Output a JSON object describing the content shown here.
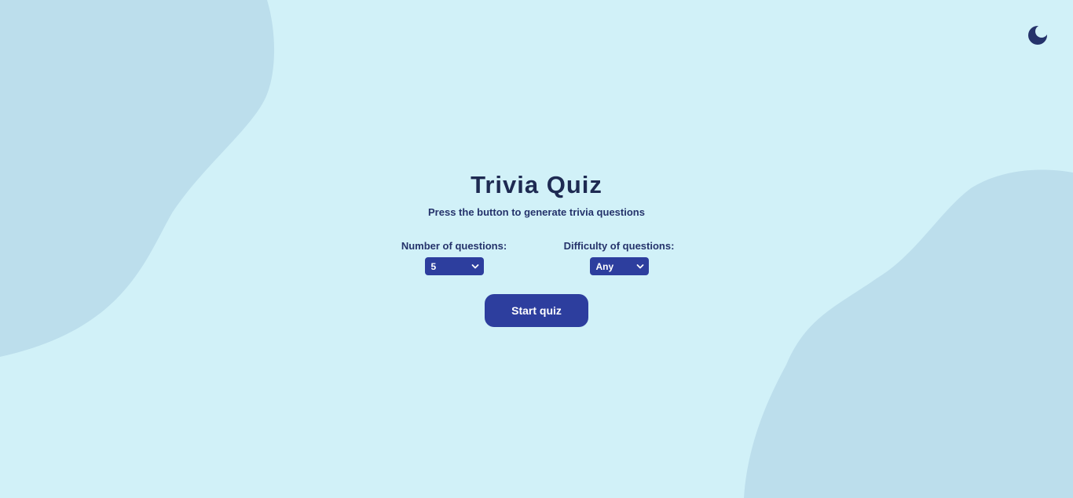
{
  "header": {
    "theme_toggle_icon": "moon-icon"
  },
  "main": {
    "title": "Trivia Quiz",
    "subtitle": "Press the button to generate trivia questions",
    "number_field": {
      "label": "Number of questions:",
      "selected": "5"
    },
    "difficulty_field": {
      "label": "Difficulty of questions:",
      "selected": "Any"
    },
    "start_button_label": "Start quiz"
  },
  "colors": {
    "background": "#d1f1f8",
    "blob": "#bcdeec",
    "accent": "#2d3e9e",
    "text_dark": "#1e2a52"
  }
}
